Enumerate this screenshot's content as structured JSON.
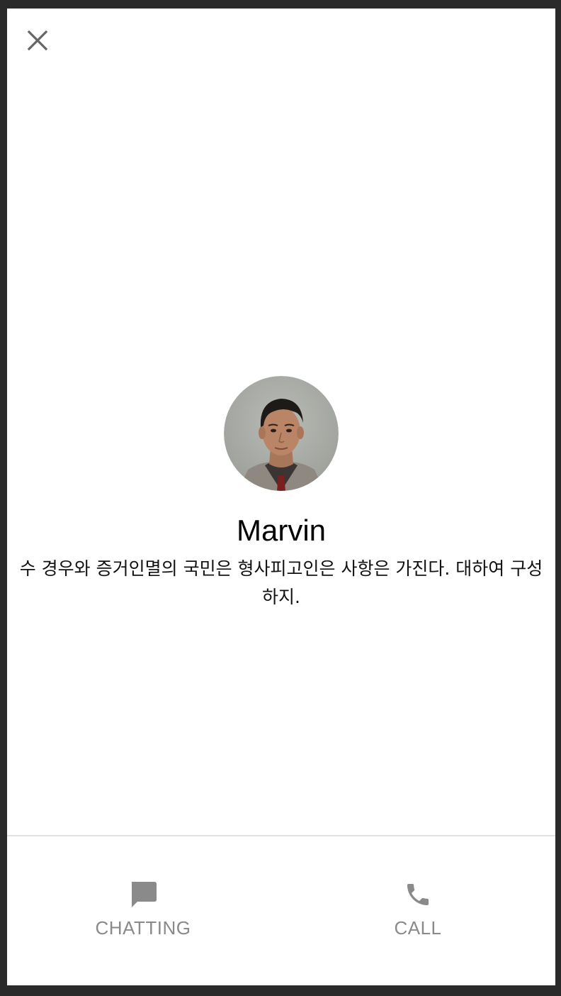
{
  "colors": {
    "background": "#ffffff",
    "frame": "#2a2a2a",
    "icon_gray": "#8a8a8a",
    "close_icon": "#666666",
    "divider": "#e2e2e2"
  },
  "header": {
    "close_icon": "close-icon"
  },
  "profile": {
    "name": "Marvin",
    "status_message": "수 경우와 증거인멸의 국민은 형사피고인은 사항은 가진다. 대하여 구성하지.",
    "avatar_icon": "avatar-photo"
  },
  "actions": {
    "chat": {
      "label": "CHATTING",
      "icon": "chat-bubble-icon"
    },
    "call": {
      "label": "CALL",
      "icon": "phone-icon"
    }
  }
}
